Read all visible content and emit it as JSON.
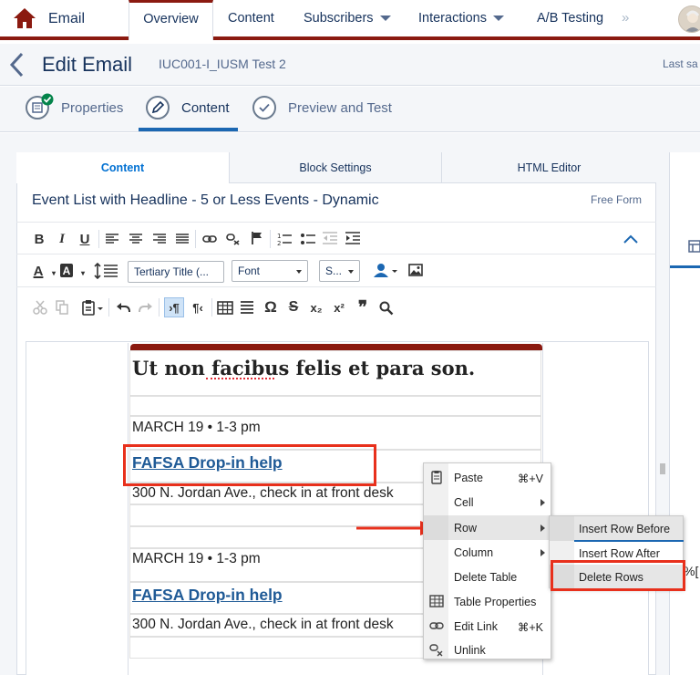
{
  "nav": {
    "app_name": "Email",
    "tabs": [
      "Overview",
      "Content",
      "Subscribers",
      "Interactions",
      "A/B Testing"
    ],
    "more": "»"
  },
  "header": {
    "title": "Edit Email",
    "subtitle": "IUC001-I_IUSM Test 2",
    "saved": "Last sa"
  },
  "steps": [
    "Properties",
    "Content",
    "Preview and Test"
  ],
  "panel_tabs": [
    "Content",
    "Block Settings",
    "HTML Editor"
  ],
  "block": {
    "name": "Event List with Headline - 5 or Less Events - Dynamic",
    "type": "Free Form"
  },
  "toolbar": {
    "style_dropdown": "Tertiary Title (...",
    "font_dropdown": "Font",
    "size_dropdown": "S..."
  },
  "email": {
    "headline": "Ut non facibus felis et para son.",
    "events": [
      {
        "date": "MARCH 19 • 1-3 pm",
        "title": "FAFSA Drop-in help",
        "address": "300 N. Jordan Ave., check in at front desk"
      },
      {
        "date": "MARCH 19 • 1-3 pm",
        "title": "FAFSA Drop-in help",
        "address": "300 N. Jordan Ave., check in at front desk"
      }
    ]
  },
  "context_menu": {
    "items": [
      {
        "label": "Paste",
        "shortcut": "⌘+V"
      },
      {
        "label": "Cell",
        "shortcut": ""
      },
      {
        "label": "Row",
        "shortcut": ""
      },
      {
        "label": "Column",
        "shortcut": ""
      },
      {
        "label": "Delete Table",
        "shortcut": ""
      },
      {
        "label": "Table Properties",
        "shortcut": ""
      },
      {
        "label": "Edit Link",
        "shortcut": "⌘+K"
      },
      {
        "label": "Unlink",
        "shortcut": ""
      }
    ],
    "submenu": [
      "Insert Row Before",
      "Insert Row After",
      "Delete Rows"
    ]
  },
  "cutoff_text": "%[",
  "colors": {
    "brand_red": "#8b1a10",
    "highlight": "#e8301c",
    "link_blue": "#1f5a96",
    "active_blue": "#1b67b2"
  },
  "icons": [
    "home-icon",
    "back-chevron-icon",
    "properties-icon",
    "pencil-icon",
    "check-icon",
    "bold-icon",
    "italic-icon",
    "underline-icon",
    "align-left-icon",
    "align-center-icon",
    "align-right-icon",
    "justify-icon",
    "link-icon",
    "unlink-icon",
    "flag-icon",
    "numbered-list-icon",
    "bullet-list-icon",
    "outdent-icon",
    "indent-icon",
    "collapse-icon",
    "text-color-icon",
    "background-color-icon",
    "line-height-icon",
    "personalization-icon",
    "image-icon",
    "cut-icon",
    "copy-icon",
    "paste-icon",
    "undo-icon",
    "redo-icon",
    "ltr-icon",
    "rtl-icon",
    "table-icon",
    "hr-icon",
    "omega-icon",
    "strikethrough-icon",
    "subscript-icon",
    "superscript-icon",
    "quote-icon",
    "search-icon"
  ]
}
